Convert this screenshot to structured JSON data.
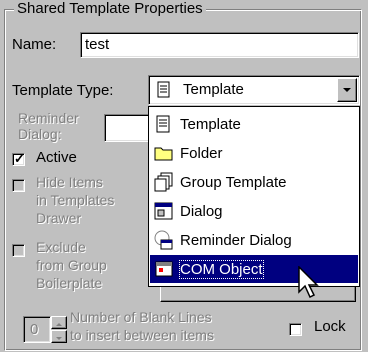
{
  "group": {
    "title": "Shared Template Properties"
  },
  "name_field": {
    "label": "Name:",
    "value": "test"
  },
  "template_type": {
    "label": "Template Type:",
    "selected": "Template"
  },
  "reminder_dialog": {
    "label_line1": "Reminder",
    "label_line2": "Dialog:"
  },
  "active": {
    "label": "Active",
    "checked": true
  },
  "hide_items": {
    "line1": "Hide Items",
    "line2": "in Templates",
    "line3": "Drawer"
  },
  "exclude": {
    "line1": "Exclude",
    "line2": "from Group",
    "line3": "Boilerplate"
  },
  "blank_lines": {
    "value": "0",
    "line1": "Number of Blank Lines",
    "line2": "to insert between items"
  },
  "lock": {
    "label": "Lock"
  },
  "dropdown_items": [
    {
      "label": "Template",
      "icon": "document-icon"
    },
    {
      "label": "Folder",
      "icon": "folder-icon"
    },
    {
      "label": "Group Template",
      "icon": "group-template-icon"
    },
    {
      "label": "Dialog",
      "icon": "dialog-icon"
    },
    {
      "label": "Reminder Dialog",
      "icon": "reminder-dialog-icon"
    },
    {
      "label": "COM Object",
      "icon": "com-object-icon",
      "selected": true
    }
  ],
  "colors": {
    "selection": "#000080",
    "face": "#c0c0c0"
  }
}
